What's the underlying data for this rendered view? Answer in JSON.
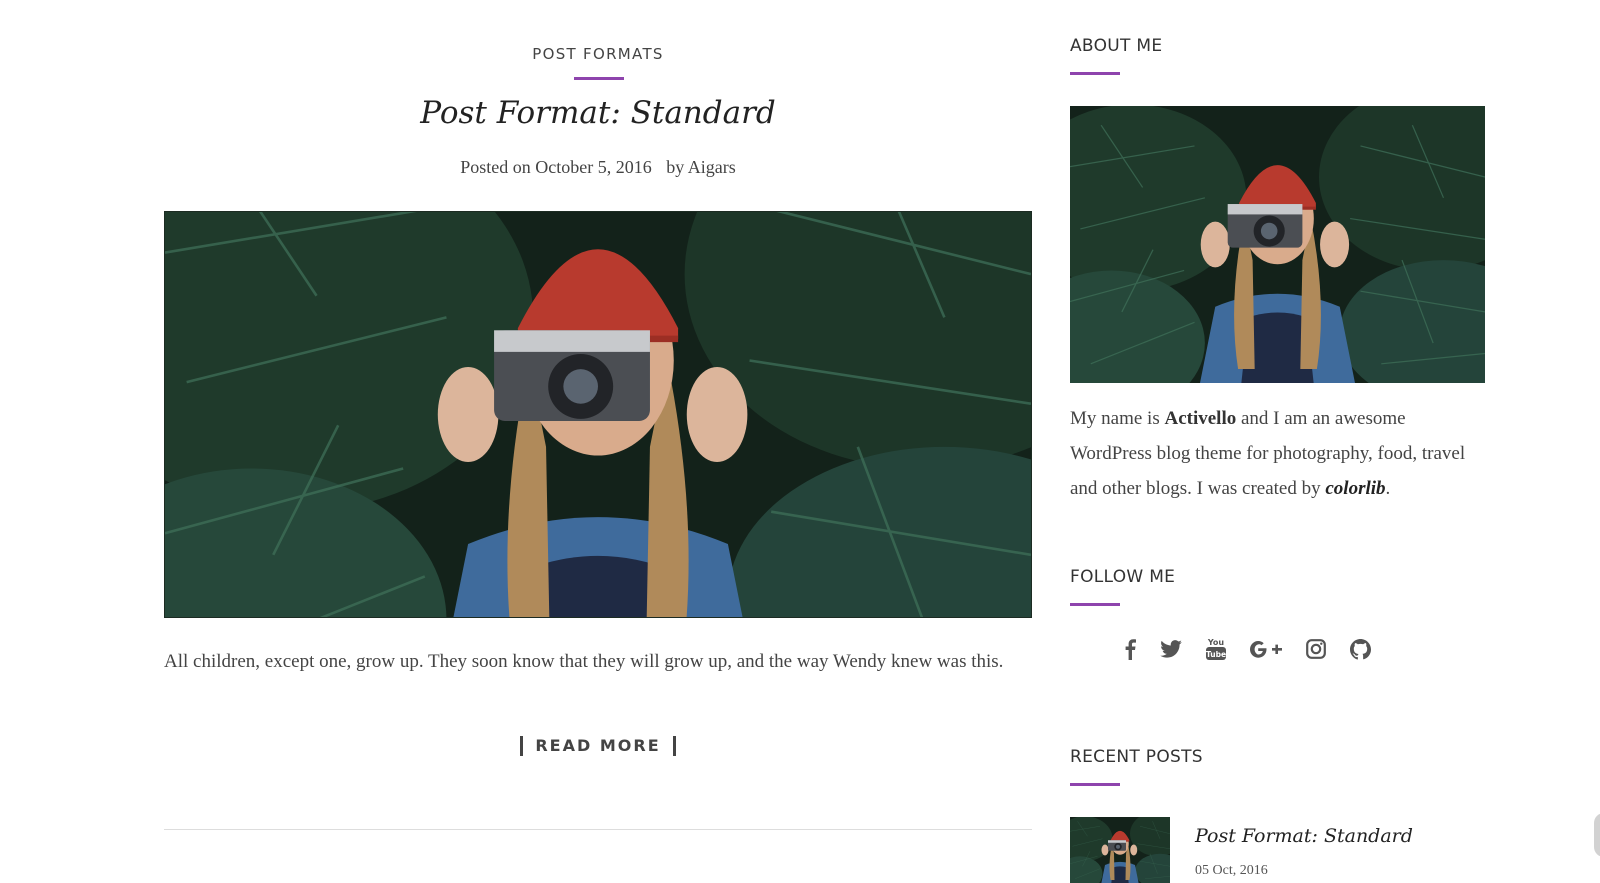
{
  "post": {
    "category": "POST FORMATS",
    "title": "Post Format: Standard",
    "meta_posted_on": "Posted on",
    "meta_date": "October 5, 2016",
    "meta_by": "by",
    "meta_author": "Aigars",
    "excerpt": "All children, except one, grow up. They soon know that they will grow up, and the way Wendy knew was this.",
    "read_more": "READ MORE"
  },
  "sidebar": {
    "about": {
      "title": "ABOUT ME",
      "text_1": "My name is ",
      "name": "Activello",
      "text_2": " and I am an awesome WordPress blog theme for photography, food, travel and other blogs. I was created by ",
      "creator": "colorlib",
      "text_3": "."
    },
    "follow": {
      "title": "FOLLOW ME",
      "icons": [
        "facebook-icon",
        "twitter-icon",
        "youtube-icon",
        "google-plus-icon",
        "instagram-icon",
        "github-icon"
      ]
    },
    "recent": {
      "title": "RECENT POSTS",
      "items": [
        {
          "title": "Post Format: Standard",
          "date": "05 Oct, 2016"
        }
      ]
    }
  },
  "colors": {
    "accent": "#8e44ad",
    "text": "#444444",
    "heading": "#222222"
  }
}
